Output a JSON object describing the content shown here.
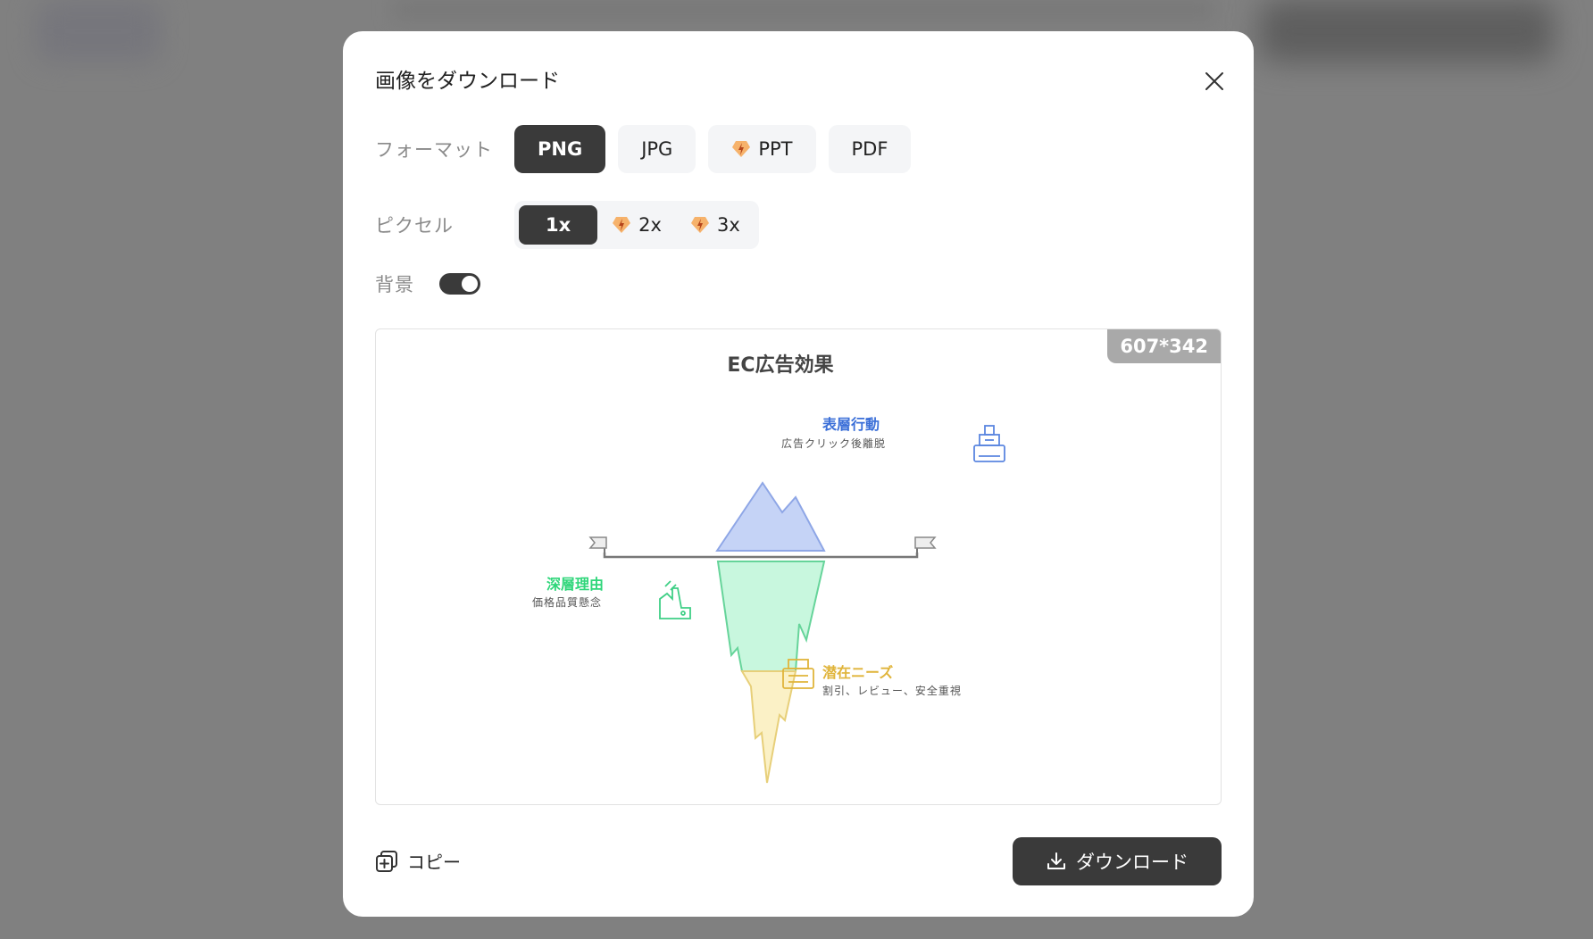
{
  "dialog": {
    "title": "画像をダウンロード",
    "format_label": "フォーマット",
    "formats": [
      {
        "label": "PNG",
        "active": true,
        "premium": false
      },
      {
        "label": "JPG",
        "active": false,
        "premium": false
      },
      {
        "label": "PPT",
        "active": false,
        "premium": true
      },
      {
        "label": "PDF",
        "active": false,
        "premium": false
      }
    ],
    "pixel_label": "ピクセル",
    "pixels": [
      {
        "label": "1x",
        "active": true,
        "premium": false
      },
      {
        "label": "2x",
        "active": false,
        "premium": true
      },
      {
        "label": "3x",
        "active": false,
        "premium": true
      }
    ],
    "background_label": "背景",
    "background_on": true,
    "preview_size": "607*342",
    "copy_label": "コピー",
    "download_label": "ダウンロード"
  },
  "diagram": {
    "title": "EC広告効果",
    "items": [
      {
        "title": "表層行動",
        "subtitle": "広告クリック後離脱",
        "color": "#3b6fd8"
      },
      {
        "title": "深層理由",
        "subtitle": "価格品質懸念",
        "color": "#2fd67a"
      },
      {
        "title": "潜在ニーズ",
        "subtitle": "割引、レビュー、安全重視",
        "color": "#e0b43a"
      }
    ]
  }
}
